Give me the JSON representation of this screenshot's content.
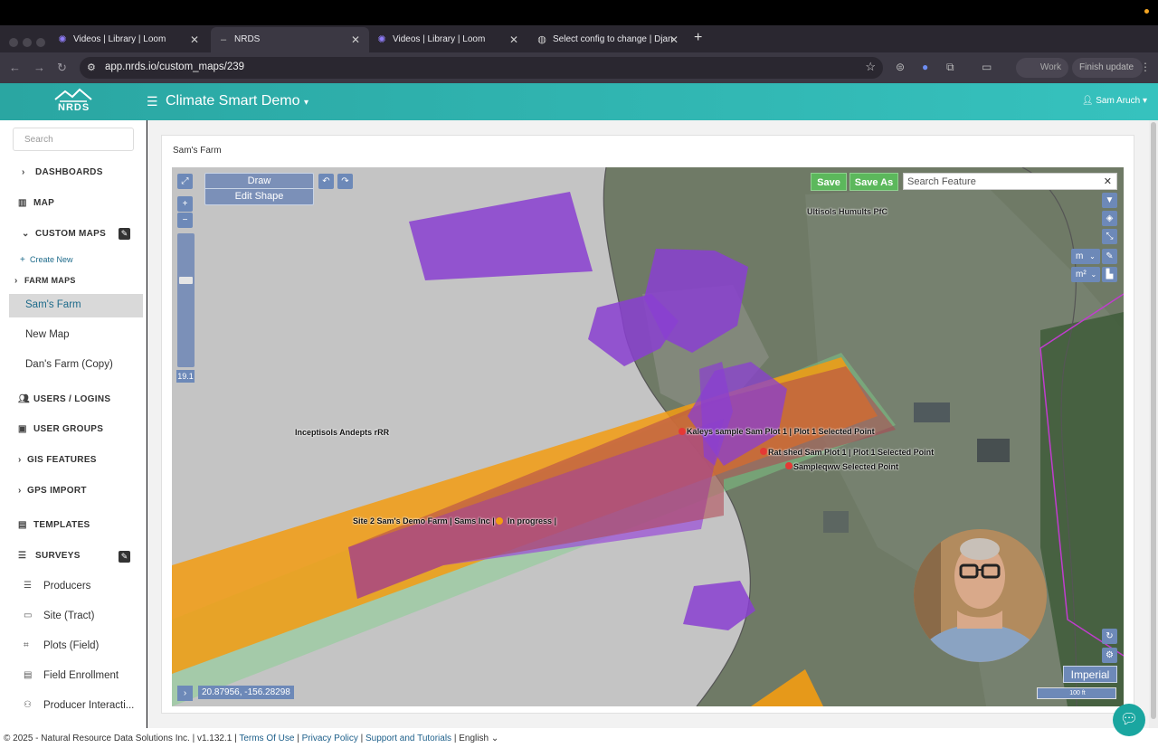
{
  "browser": {
    "tabs": [
      {
        "title": "Videos | Library | Loom",
        "favicon": "loom-icon"
      },
      {
        "title": "NRDS",
        "favicon": "nrds-icon"
      },
      {
        "title": "Videos | Library | Loom",
        "favicon": "loom-icon"
      },
      {
        "title": "Select config to change | Djan",
        "favicon": "globe-icon"
      }
    ],
    "url": "app.nrds.io/custom_maps/239",
    "work_label": "Work",
    "finish_update_label": "Finish update"
  },
  "header": {
    "logo_text": "NRDS",
    "app_title": "Climate Smart Demo",
    "user_name": "Sam Aruch"
  },
  "sidebar": {
    "search_placeholder": "Search",
    "dashboards": "DASHBOARDS",
    "map": "MAP",
    "custom_maps": "CUSTOM MAPS",
    "create_new": "Create New",
    "farm_maps": "FARM MAPS",
    "maps": [
      "Sam's Farm",
      "New Map",
      "Dan's Farm (Copy)"
    ],
    "users_logins": "USERS / LOGINS",
    "user_groups": "USER GROUPS",
    "gis_features": "GIS FEATURES",
    "gps_import": "GPS IMPORT",
    "templates": "TEMPLATES",
    "surveys": "SURVEYS",
    "survey_items": [
      "Producers",
      "Site (Tract)",
      "Plots (Field)",
      "Field Enrollment",
      "Producer Interacti..."
    ]
  },
  "page": {
    "breadcrumb": "Sam's Farm"
  },
  "map": {
    "draw_label": "Draw",
    "edit_shape_label": "Edit Shape",
    "save_label": "Save",
    "save_as_label": "Save As",
    "search_placeholder": "Search Feature",
    "zoom_level": "19.1",
    "coordinates": "20.87956, -156.28298",
    "units_label": "Imperial",
    "scale_label": "100 ft",
    "length_unit": "m",
    "area_unit": "m²",
    "labels": {
      "ultisols": "Ultisols Humults PfC",
      "inceptisols": "Inceptisols Andepts rRR",
      "kaleys": "Kaleys sample Sam Plot 1 | Plot 1 Selected Point",
      "rat_shed": "Rat shed  Sam Plot 1 | Plot 1 Selected Point",
      "sampleqww": "Sampleqww Selected Point",
      "site2": "Site 2 Sam's Demo Farm | Sams Inc |",
      "in_progress": "In progress |"
    },
    "colors": {
      "polygon_purple": "#8a3fd1",
      "polygon_red": "#c0392b",
      "orange_band": "#f39c12",
      "control_blue": "#6d89b8",
      "save_green": "#5cb85c"
    }
  },
  "footer": {
    "copyright": "© 2025 - Natural Resource Data Solutions Inc. | v1.132.1 |",
    "terms": "Terms Of Use",
    "privacy": "Privacy Policy",
    "support": "Support and Tutorials",
    "language": "English"
  }
}
